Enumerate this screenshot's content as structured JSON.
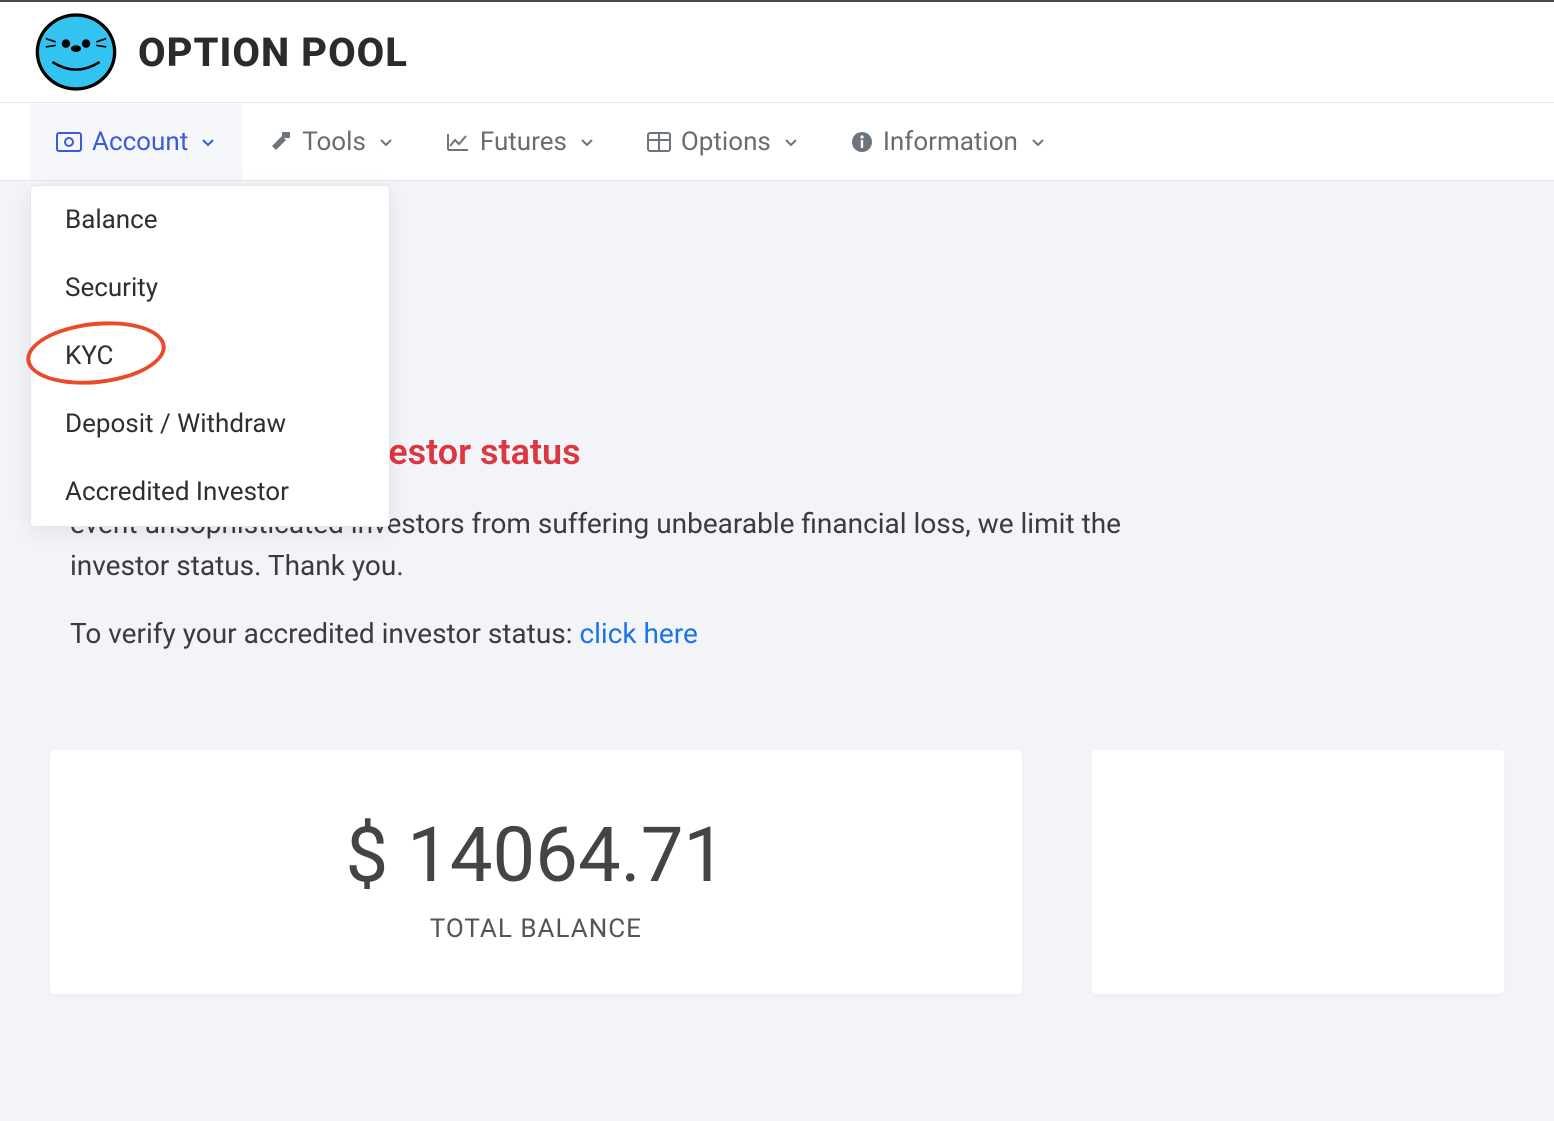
{
  "brand": {
    "name": "OPTION POOL"
  },
  "nav": {
    "account": "Account",
    "tools": "Tools",
    "futures": "Futures",
    "options": "Options",
    "information": "Information"
  },
  "dropdown": {
    "items": [
      {
        "label": "Balance"
      },
      {
        "label": "Security"
      },
      {
        "label": "KYC"
      },
      {
        "label": "Deposit / Withdraw"
      },
      {
        "label": "Accredited Investor"
      }
    ]
  },
  "notice": {
    "title_fragment": "rding accredited investor status",
    "body_line1_fragment": "event unsophisticated investors from suffering unbearable financial loss, we limit the",
    "body_line1_tail": "investor status. Thank you.",
    "line2_prefix": "To verify your accredited investor status: ",
    "line2_link": "click here"
  },
  "balance": {
    "amount": "$ 14064.71",
    "label": "TOTAL BALANCE"
  }
}
